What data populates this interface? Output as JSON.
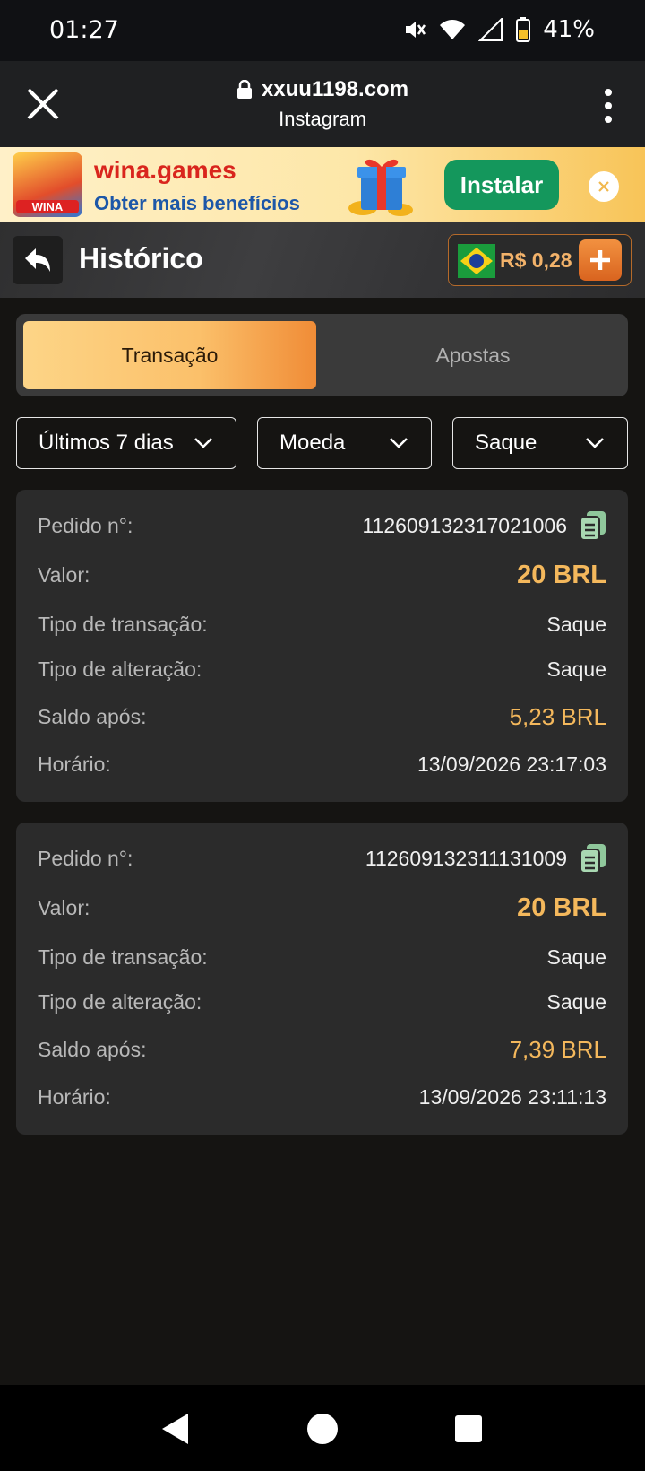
{
  "status_bar": {
    "time": "01:27",
    "battery_percent": "41%"
  },
  "browser": {
    "url": "xxuu1198.com",
    "subtitle": "Instagram"
  },
  "ad_banner": {
    "app_logo_text": "WINA",
    "brand": "wina.games",
    "tagline": "Obter mais benefícios",
    "install_label": "Instalar"
  },
  "header": {
    "title": "Histórico",
    "balance": "R$ 0,28"
  },
  "tabs": [
    {
      "label": "Transação",
      "active": true
    },
    {
      "label": "Apostas",
      "active": false
    }
  ],
  "filters": {
    "period": "Últimos 7 dias",
    "currency": "Moeda",
    "type": "Saque"
  },
  "labels": {
    "order_no": "Pedido n°:",
    "amount": "Valor:",
    "transaction_type": "Tipo de transação:",
    "change_type": "Tipo de alteração:",
    "balance_after": "Saldo após:",
    "time": "Horário:"
  },
  "transactions": [
    {
      "order_no": "112609132317021006",
      "amount": "20 BRL",
      "transaction_type": "Saque",
      "change_type": "Saque",
      "balance_after": "5,23 BRL",
      "time": "13/09/2026 23:17:03"
    },
    {
      "order_no": "112609132311131009",
      "amount": "20 BRL",
      "transaction_type": "Saque",
      "change_type": "Saque",
      "balance_after": "7,39 BRL",
      "time": "13/09/2026 23:11:13"
    }
  ],
  "colors": {
    "accent": "#f4b85c",
    "install_green": "#14975c",
    "card_bg": "#2b2b2b",
    "page_bg": "#151412"
  }
}
